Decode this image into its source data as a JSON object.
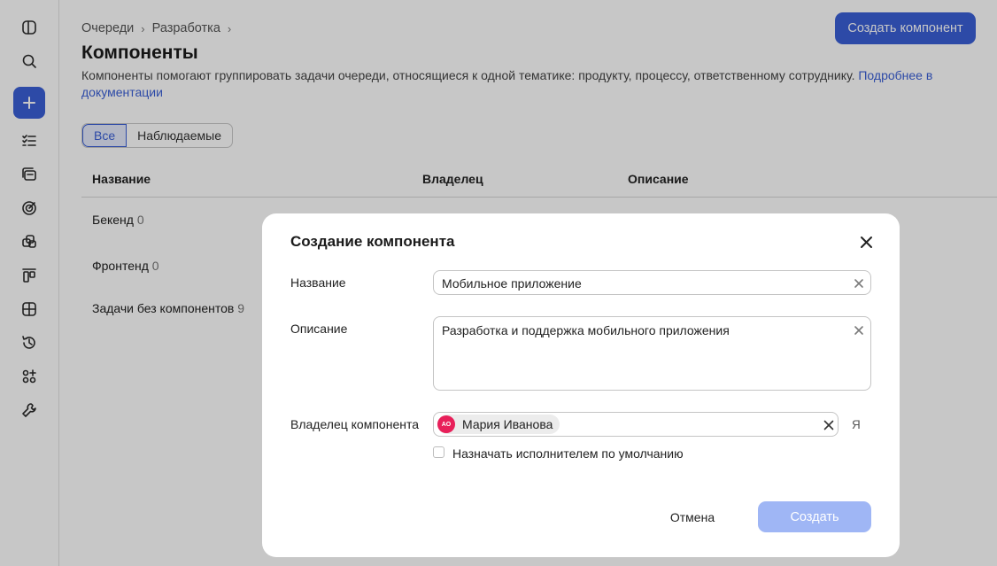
{
  "breadcrumb": {
    "items": [
      "Очереди",
      "Разработка"
    ],
    "sep": "›"
  },
  "page": {
    "title": "Компоненты",
    "description": "Компоненты помогают группировать задачи очереди, относящиеся к одной тематике: продукту, процессу, ответственному сотруднику.",
    "doc_link": "Подробнее в документации",
    "create_button": "Создать компонент"
  },
  "filters": {
    "all": "Все",
    "watched": "Наблюдаемые"
  },
  "table": {
    "columns": [
      "Название",
      "Владелец",
      "Описание"
    ],
    "rows": [
      {
        "name": "Бекенд",
        "count": "0"
      },
      {
        "name": "Фронтенд",
        "count": "0"
      },
      {
        "name": "Задачи без компонентов",
        "count": "9"
      }
    ]
  },
  "dialog": {
    "title": "Создание компонента",
    "name_label": "Название",
    "name_value": "Мобильное приложение",
    "desc_label": "Описание",
    "desc_value": "Разработка и поддержка мобильного приложения",
    "owner_label": "Владелец компонента",
    "owner_initials": "АО",
    "owner_name": "Мария Иванова",
    "me_link": "Я",
    "default_assignee_label": "Назначать исполнителем по умолчанию",
    "cancel": "Отмена",
    "submit": "Создать"
  },
  "sidebar_icons": [
    "sidebar-toggle-icon",
    "search-icon",
    "plus-icon",
    "tasks-icon",
    "queues-icon",
    "goals-icon",
    "projects-icon",
    "boards-icon",
    "dashboards-icon",
    "history-icon",
    "apps-icon",
    "wrench-icon"
  ],
  "colors": {
    "accent": "#3a5fd6",
    "avatar": "#e8205a",
    "disabled": "#9fb6f5"
  }
}
